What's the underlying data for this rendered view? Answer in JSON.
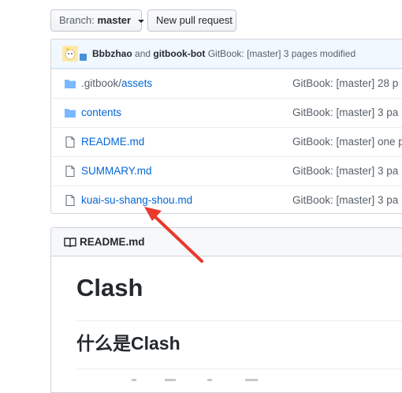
{
  "toolbar": {
    "branch_label": "Branch:",
    "branch_value": "master",
    "new_pr_label": "New pull request"
  },
  "commit": {
    "author1": "Bbbzhao",
    "and_text": "and",
    "author2": "gitbook-bot",
    "message": "GitBook: [master] 3 pages modified"
  },
  "files": [
    {
      "type": "folder",
      "prefix": ".gitbook/",
      "name": "assets",
      "message": "GitBook: [master] 28 p"
    },
    {
      "type": "folder",
      "prefix": "",
      "name": "contents",
      "message": "GitBook: [master] 3 pa"
    },
    {
      "type": "file",
      "prefix": "",
      "name": "README.md",
      "message": "GitBook: [master] one p"
    },
    {
      "type": "file",
      "prefix": "",
      "name": "SUMMARY.md",
      "message": "GitBook: [master] 3 pa"
    },
    {
      "type": "file",
      "prefix": "",
      "name": "kuai-su-shang-shou.md",
      "message": "GitBook: [master] 3 pa"
    }
  ],
  "readme": {
    "header": "README.md",
    "h1": "Clash",
    "h2": "什么是Clash"
  },
  "colors": {
    "link": "#0366d6",
    "folder_icon": "#79b8ff",
    "arrow": "#e8392c"
  }
}
